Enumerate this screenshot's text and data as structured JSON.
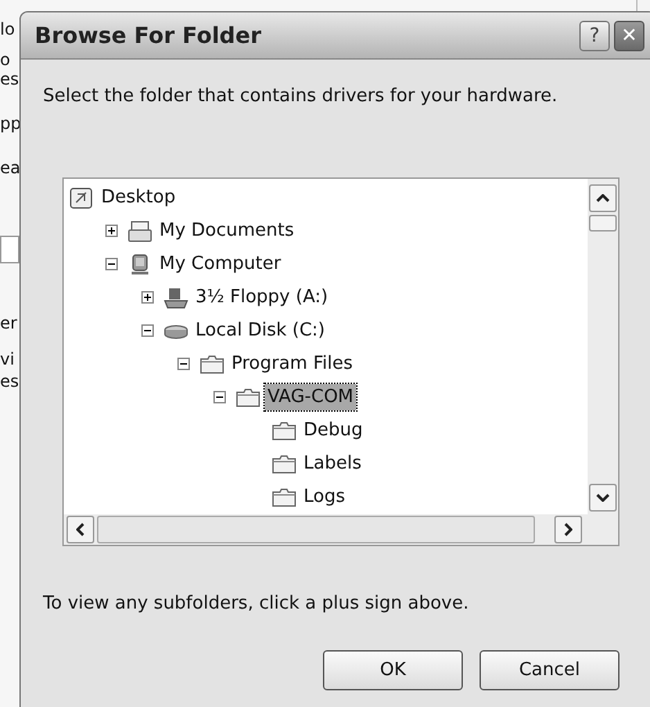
{
  "background_window": {
    "fragments": [
      "lo",
      "o",
      "es",
      "pp",
      "ea",
      "er",
      "vi",
      "es"
    ]
  },
  "dialog": {
    "title": "Browse For Folder",
    "title_buttons": [
      {
        "kind": "help",
        "label": "?"
      },
      {
        "kind": "close",
        "label": "✕"
      }
    ],
    "instruction": "Select the folder that contains drivers for your hardware.",
    "tree": [
      {
        "label": "Desktop",
        "kind": "desktop",
        "selected": false,
        "children": [
          {
            "label": "My Documents",
            "kind": "documents",
            "expanded": false,
            "selected": false
          },
          {
            "label": "My Computer",
            "kind": "computer",
            "expanded": true,
            "selected": false,
            "children": [
              {
                "label": "3½ Floppy (A:)",
                "kind": "floppy",
                "expanded": false,
                "selected": false
              },
              {
                "label": "Local Disk (C:)",
                "kind": "disk",
                "expanded": true,
                "selected": false,
                "children": [
                  {
                    "label": "Program Files",
                    "kind": "folder",
                    "expanded": true,
                    "selected": false,
                    "children": [
                      {
                        "label": "VAG-COM",
                        "kind": "folder",
                        "expanded": true,
                        "selected": true,
                        "children": [
                          {
                            "label": "Debug",
                            "kind": "folder",
                            "selected": false
                          },
                          {
                            "label": "Labels",
                            "kind": "folder",
                            "selected": false
                          },
                          {
                            "label": "Logs",
                            "kind": "folder",
                            "selected": false
                          }
                        ]
                      }
                    ]
                  }
                ]
              }
            ]
          }
        ]
      }
    ],
    "hint": "To view any subfolders, click a plus sign above.",
    "buttons": [
      {
        "label": "OK"
      },
      {
        "label": "Cancel"
      }
    ]
  }
}
